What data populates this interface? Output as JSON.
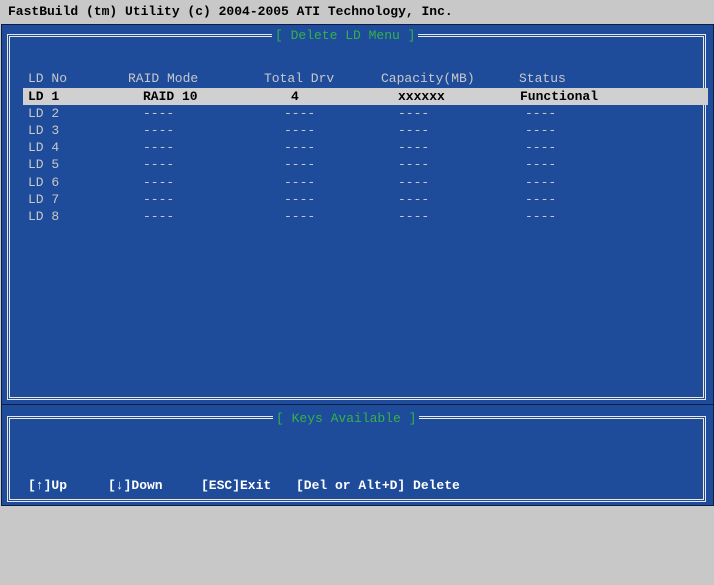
{
  "window": {
    "title": "FastBuild (tm) Utility (c) 2004-2005 ATI Technology, Inc."
  },
  "main_panel": {
    "frame_title": "[ Delete LD Menu ]",
    "columns": [
      "LD No",
      "RAID Mode",
      "Total Drv",
      "Capacity(MB)",
      "Status"
    ],
    "rows": [
      {
        "ld": "LD 1",
        "raid_mode": "RAID 10",
        "total_drv": "4",
        "capacity": "xxxxxx",
        "status": "Functional",
        "selected": true
      },
      {
        "ld": "LD 2",
        "raid_mode": "----",
        "total_drv": "----",
        "capacity": "----",
        "status": "----",
        "selected": false
      },
      {
        "ld": "LD 3",
        "raid_mode": "----",
        "total_drv": "----",
        "capacity": "----",
        "status": "----",
        "selected": false
      },
      {
        "ld": "LD 4",
        "raid_mode": "----",
        "total_drv": "----",
        "capacity": "----",
        "status": "----",
        "selected": false
      },
      {
        "ld": "LD 5",
        "raid_mode": "----",
        "total_drv": "----",
        "capacity": "----",
        "status": "----",
        "selected": false
      },
      {
        "ld": "LD 6",
        "raid_mode": "----",
        "total_drv": "----",
        "capacity": "----",
        "status": "----",
        "selected": false
      },
      {
        "ld": "LD 7",
        "raid_mode": "----",
        "total_drv": "----",
        "capacity": "----",
        "status": "----",
        "selected": false
      },
      {
        "ld": "LD 8",
        "raid_mode": "----",
        "total_drv": "----",
        "capacity": "----",
        "status": "----",
        "selected": false
      }
    ]
  },
  "keys_panel": {
    "frame_title": "[ Keys Available ]",
    "keys": [
      {
        "label": "[↑]Up"
      },
      {
        "label": "[↓]Down"
      },
      {
        "label": "[ESC]Exit"
      },
      {
        "label": "[Del or Alt+D] Delete"
      }
    ]
  },
  "colors": {
    "background": "#1e4c9a",
    "title_bar": "#c8c8c8",
    "frame_title_text": "#33b249",
    "selection_bar": "#d0d0d0",
    "text": "#c8c8c8"
  }
}
